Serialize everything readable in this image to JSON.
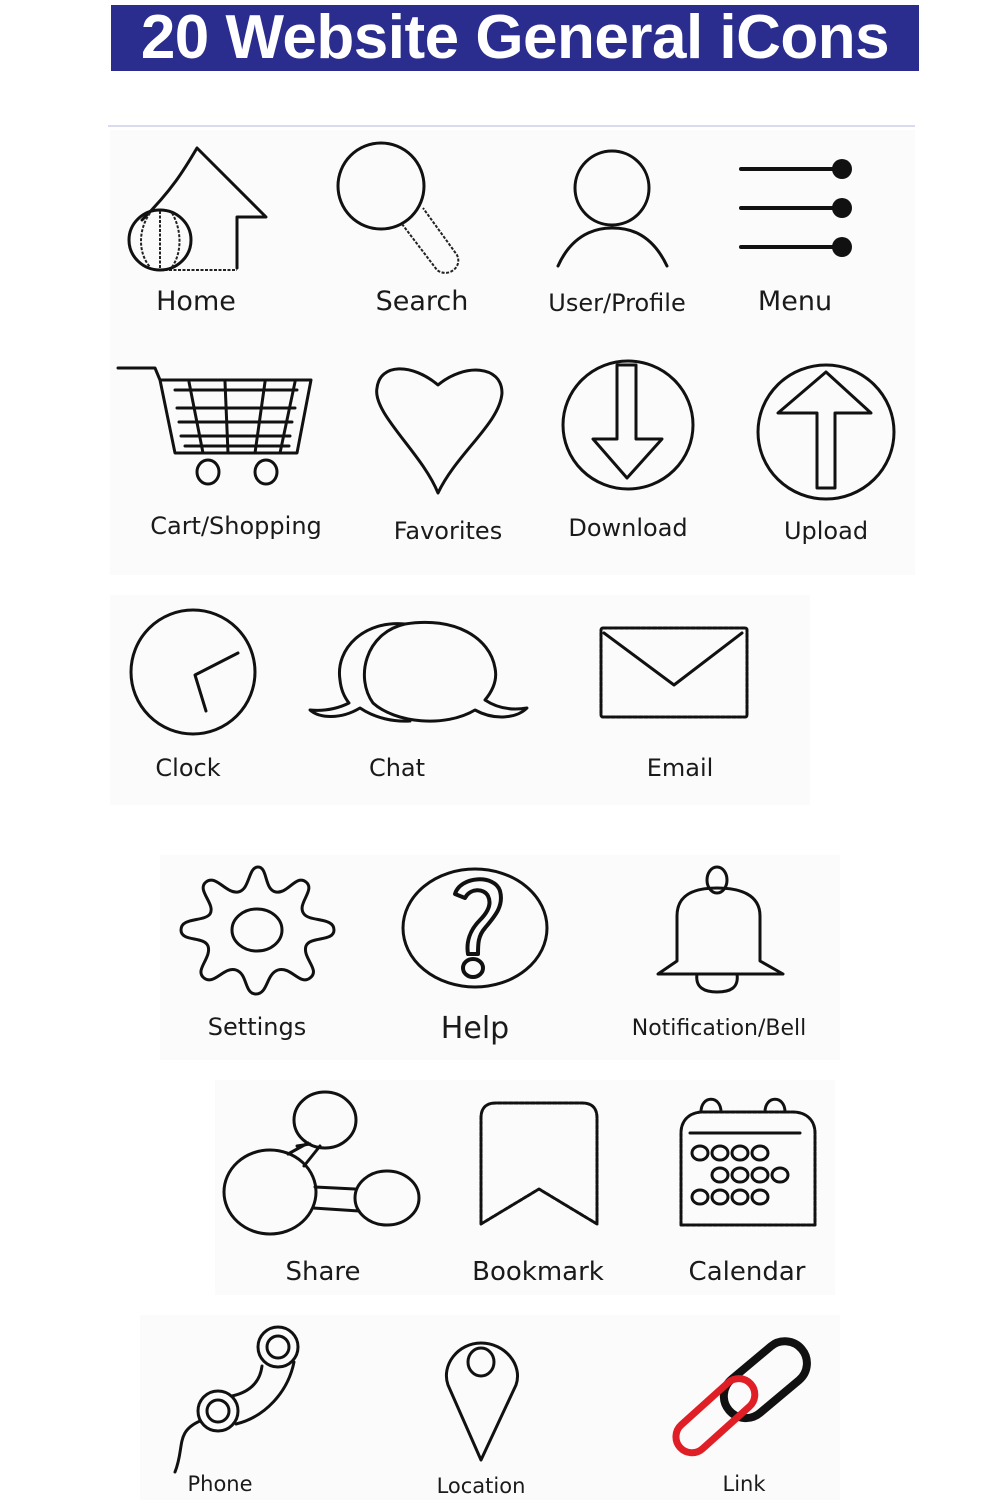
{
  "title": "20 Website General iCons",
  "colors": {
    "banner_bg": "#2b2d8e",
    "banner_text": "#ffffff",
    "icon_stroke": "#111111",
    "link_accent": "#e01e26"
  },
  "rows": [
    {
      "icons": [
        {
          "label": "Home",
          "icon": "home-icon"
        },
        {
          "label": "Search",
          "icon": "search-icon"
        },
        {
          "label": "User/Profile",
          "icon": "user-icon"
        },
        {
          "label": "Menu",
          "icon": "menu-icon"
        }
      ]
    },
    {
      "icons": [
        {
          "label": "Cart/Shopping",
          "icon": "cart-icon"
        },
        {
          "label": "Favorites",
          "icon": "heart-icon"
        },
        {
          "label": "Download",
          "icon": "download-icon"
        },
        {
          "label": "Upload",
          "icon": "upload-icon"
        }
      ]
    },
    {
      "icons": [
        {
          "label": "Clock",
          "icon": "clock-icon"
        },
        {
          "label": "Chat",
          "icon": "chat-icon"
        },
        {
          "label": "Email",
          "icon": "email-icon"
        }
      ]
    },
    {
      "icons": [
        {
          "label": "Settings",
          "icon": "gear-icon"
        },
        {
          "label": "Help",
          "icon": "help-icon"
        },
        {
          "label": "Notification/Bell",
          "icon": "bell-icon"
        }
      ]
    },
    {
      "icons": [
        {
          "label": "Share",
          "icon": "share-icon"
        },
        {
          "label": "Bookmark",
          "icon": "bookmark-icon"
        },
        {
          "label": "Calendar",
          "icon": "calendar-icon"
        }
      ]
    },
    {
      "icons": [
        {
          "label": "Phone",
          "icon": "phone-icon"
        },
        {
          "label": "Location",
          "icon": "location-pin-icon"
        },
        {
          "label": "Link",
          "icon": "link-icon"
        }
      ]
    }
  ]
}
